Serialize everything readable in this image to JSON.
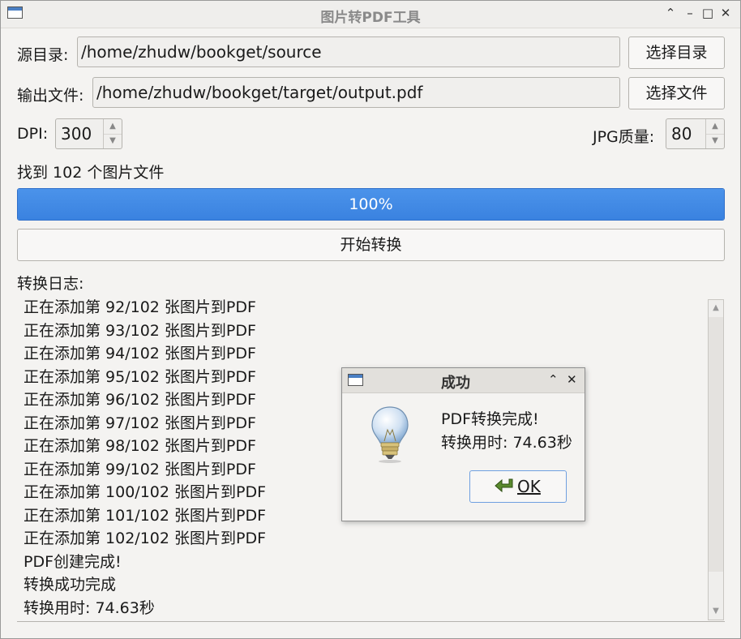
{
  "window": {
    "title": "图片转PDF工具",
    "controls": {
      "minimize_up": "⌃",
      "minimize": "–",
      "maximize": "□",
      "close": "✕"
    }
  },
  "source": {
    "label": "源目录:",
    "value": "/home/zhudw/bookget/source",
    "button": "选择目录"
  },
  "output": {
    "label": "输出文件:",
    "value": "/home/zhudw/bookget/target/output.pdf",
    "button": "选择文件"
  },
  "dpi": {
    "label": "DPI:",
    "value": "300"
  },
  "jpg_quality": {
    "label": "JPG质量:",
    "value": "80"
  },
  "found_text": "找到 102 个图片文件",
  "progress": {
    "value": 1.0,
    "text": "100%"
  },
  "start_button": "开始转换",
  "log": {
    "label": "转换日志:",
    "lines": [
      "正在添加第 92/102 张图片到PDF",
      "正在添加第 93/102 张图片到PDF",
      "正在添加第 94/102 张图片到PDF",
      "正在添加第 95/102 张图片到PDF",
      "正在添加第 96/102 张图片到PDF",
      "正在添加第 97/102 张图片到PDF",
      "正在添加第 98/102 张图片到PDF",
      "正在添加第 99/102 张图片到PDF",
      "正在添加第 100/102 张图片到PDF",
      "正在添加第 101/102 张图片到PDF",
      "正在添加第 102/102 张图片到PDF",
      "PDF创建完成!",
      "转换成功完成",
      "转换用时: 74.63秒"
    ]
  },
  "dialog": {
    "title": "成功",
    "message_line1": "PDF转换完成!",
    "message_line2": "转换用时: 74.63秒",
    "ok_button": "OK",
    "icon": "lightbulb-icon"
  },
  "colors": {
    "progress_fill": "#3a82e0",
    "window_bg": "#f4f3f1"
  }
}
